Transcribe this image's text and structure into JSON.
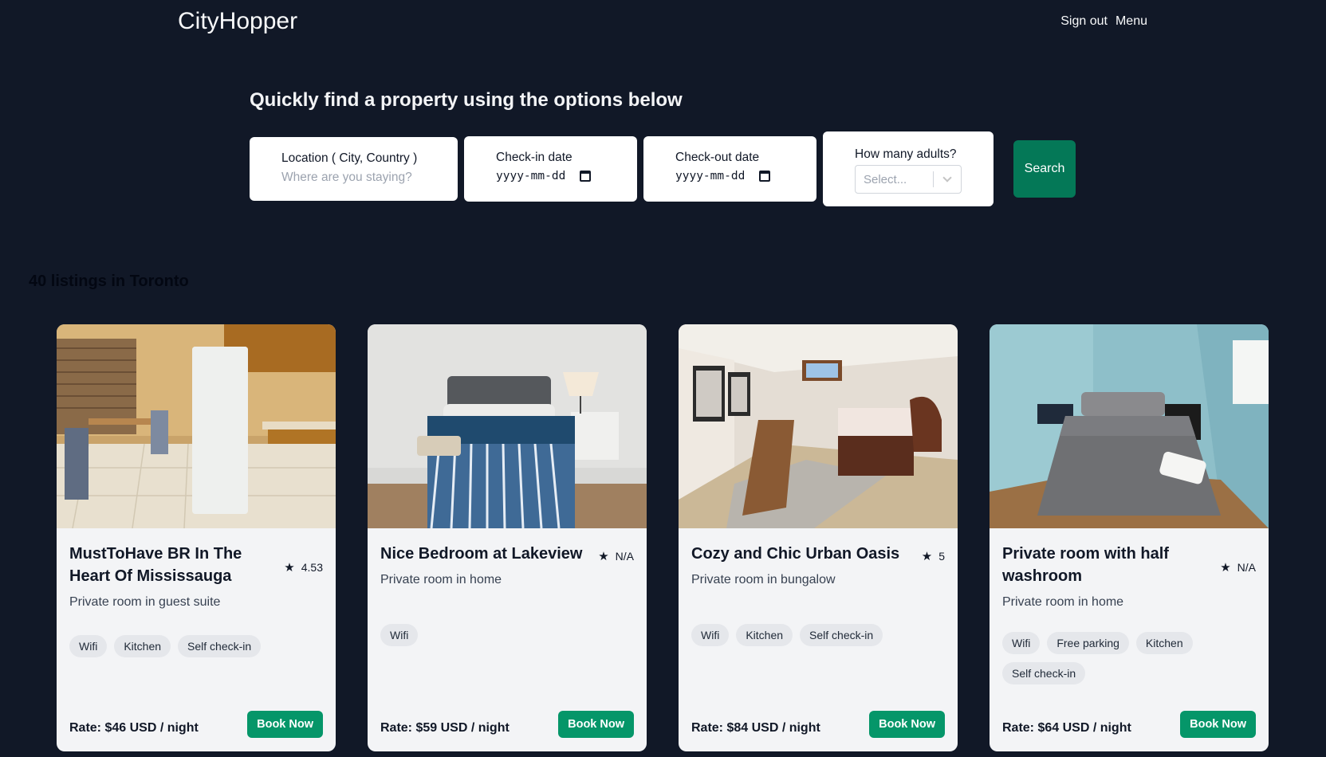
{
  "header": {
    "brand": "CityHopper",
    "nav": {
      "sign_out": "Sign out",
      "menu": "Menu"
    }
  },
  "search": {
    "heading": "Quickly find a property using the options below",
    "location": {
      "label": "Location ( City, Country )",
      "placeholder": "Where are you staying?"
    },
    "checkin": {
      "label": "Check-in date",
      "value": "yyyy-mm-dd"
    },
    "checkout": {
      "label": "Check-out date",
      "value": "yyyy-mm-dd"
    },
    "adults": {
      "label": "How many adults?",
      "placeholder": "Select..."
    },
    "button": "Search"
  },
  "results": {
    "count_label": "40 listings in Toronto",
    "listings": [
      {
        "title": "MustToHave BR In The Heart Of Mississauga",
        "rating": "4.53",
        "subtitle": "Private room in guest suite",
        "amenities": [
          "Wifi",
          "Kitchen",
          "Self check-in"
        ],
        "rate": "Rate: $46 USD / night",
        "book": "Book Now"
      },
      {
        "title": "Nice Bedroom at Lakeview",
        "rating": "N/A",
        "subtitle": "Private room in home",
        "amenities": [
          "Wifi"
        ],
        "rate": "Rate: $59 USD / night",
        "book": "Book Now"
      },
      {
        "title": "Cozy and Chic Urban Oasis",
        "rating": "5",
        "subtitle": "Private room in bungalow",
        "amenities": [
          "Wifi",
          "Kitchen",
          "Self check-in"
        ],
        "rate": "Rate: $84 USD / night",
        "book": "Book Now"
      },
      {
        "title": "Private room with half washroom",
        "rating": "N/A",
        "subtitle": "Private room in home",
        "amenities": [
          "Wifi",
          "Free parking",
          "Kitchen",
          "Self check-in"
        ],
        "rate": "Rate: $64 USD / night",
        "book": "Book Now"
      }
    ]
  },
  "icons": {
    "star": "star-icon",
    "calendar": "calendar-icon",
    "chevron": "chevron-down-icon"
  },
  "colors": {
    "background": "#111827",
    "card": "#f3f4f6",
    "search_button": "#047857",
    "book_button": "#059669"
  }
}
